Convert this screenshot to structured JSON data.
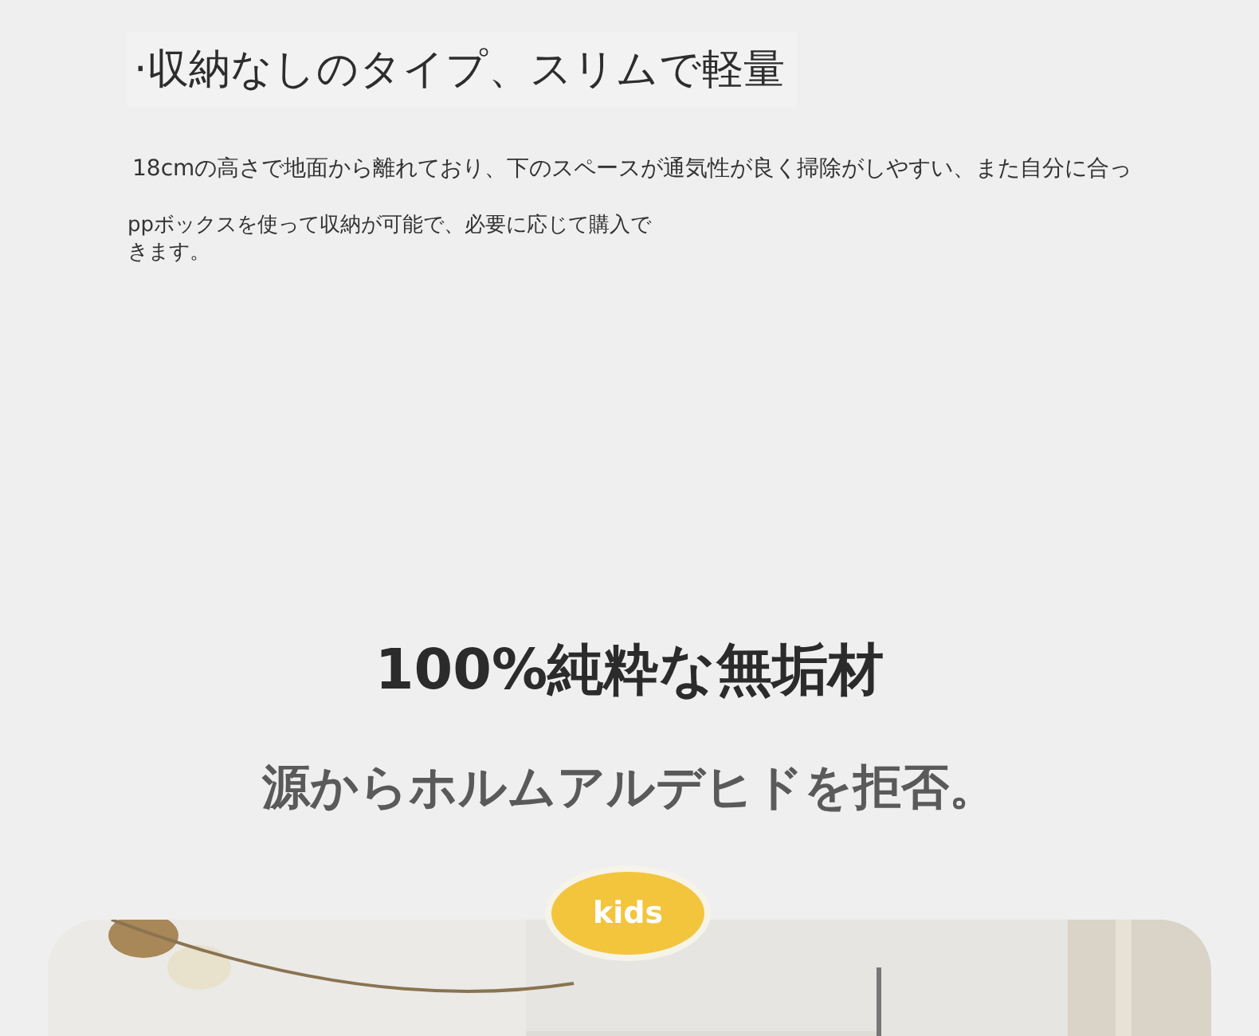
{
  "feature": {
    "title": "·収納なしのタイプ、スリムで軽量",
    "description": "18cmの高さで地面から離れており、下のスペースが通気性が良く掃除がしやすい、また自分に合っ",
    "note": "ppボックスを使って収納が可能で、必要に応じて購入できます。"
  },
  "material": {
    "headline": "100%純粋な無垢材",
    "subheadline": "源からホルムアルデヒドを拒否。"
  },
  "showcase": {
    "badge": "kids"
  }
}
